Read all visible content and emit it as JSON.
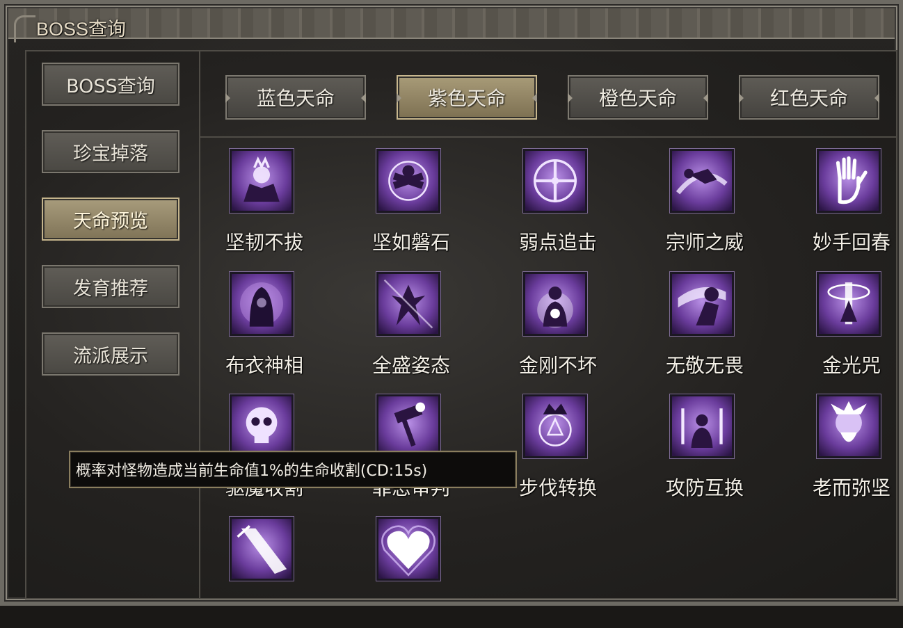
{
  "window": {
    "title": "BOSS查询"
  },
  "sidebar": {
    "items": [
      {
        "label": "BOSS查询",
        "active": false
      },
      {
        "label": "珍宝掉落",
        "active": false
      },
      {
        "label": "天命预览",
        "active": true
      },
      {
        "label": "发育推荐",
        "active": false
      },
      {
        "label": "流派展示",
        "active": false
      }
    ]
  },
  "tabs": [
    {
      "label": "蓝色天命",
      "active": false
    },
    {
      "label": "紫色天命",
      "active": true
    },
    {
      "label": "橙色天命",
      "active": false
    },
    {
      "label": "红色天命",
      "active": false
    }
  ],
  "skills": [
    {
      "name": "坚韧不拔",
      "icon": "demon-throne-icon"
    },
    {
      "name": "坚如磐石",
      "icon": "crossed-arms-orb-icon"
    },
    {
      "name": "弱点追击",
      "icon": "crosshair-icon"
    },
    {
      "name": "宗师之威",
      "icon": "flying-kick-icon"
    },
    {
      "name": "妙手回春",
      "icon": "glowing-hand-icon"
    },
    {
      "name": "布衣神相",
      "icon": "hooded-sage-icon"
    },
    {
      "name": "全盛姿态",
      "icon": "power-stance-icon"
    },
    {
      "name": "金刚不坏",
      "icon": "radiant-monk-icon"
    },
    {
      "name": "无敬无畏",
      "icon": "shadow-warrior-icon"
    },
    {
      "name": "金光咒",
      "icon": "golden-light-pillar-icon"
    },
    {
      "name": "驱魔收割",
      "icon": "skull-icon"
    },
    {
      "name": "罪恶审判",
      "icon": "judgment-hammer-icon"
    },
    {
      "name": "步伐转换",
      "icon": "demon-sigil-icon"
    },
    {
      "name": "攻防互换",
      "icon": "swords-meditation-icon"
    },
    {
      "name": "老而弥坚",
      "icon": "old-master-icon"
    },
    {
      "name": "",
      "icon": "light-beam-icon"
    },
    {
      "name": "",
      "icon": "glowing-heart-icon"
    }
  ],
  "tooltip": {
    "text": "概率对怪物造成当前生命值1%的生命收割(CD:15s)"
  },
  "colors": {
    "skill_purple": "#6a3c9c",
    "skill_glow": "#e7d8ff",
    "active_gold": "#a89c7c"
  }
}
